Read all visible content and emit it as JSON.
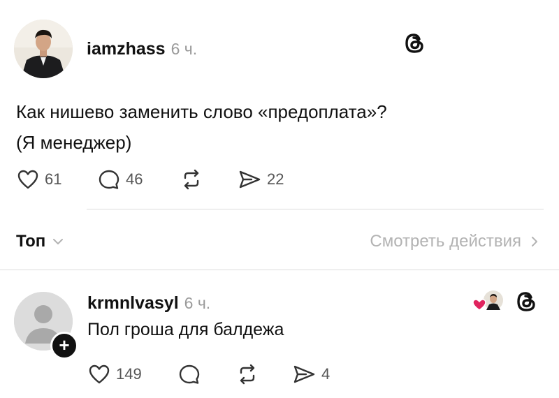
{
  "post": {
    "username": "iamzhass",
    "time": "6 ч.",
    "text_line1": "Как нишево заменить слово «предоплата»?",
    "text_line2": "(Я менеджер)",
    "likes": "61",
    "comments": "46",
    "shares": "22",
    "threads_icon": "threads-logo-icon"
  },
  "sort": {
    "label": "Топ",
    "view_activity": "Смотреть действия"
  },
  "reply": {
    "username": "krmnlvasyl",
    "time": "6 ч.",
    "text": "Пол гроша для балдежа",
    "likes": "149",
    "shares": "4"
  }
}
